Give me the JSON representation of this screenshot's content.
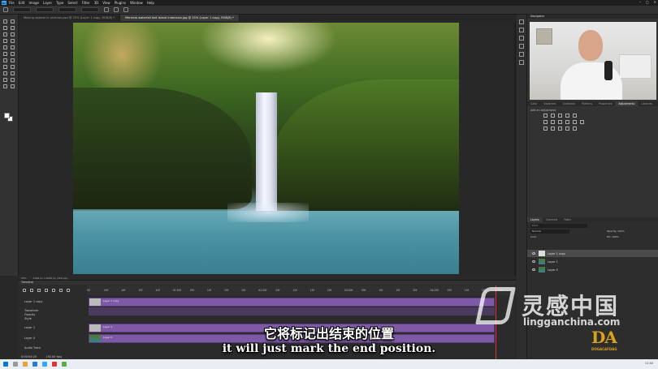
{
  "menubar": {
    "items": [
      "File",
      "Edit",
      "Image",
      "Layer",
      "Type",
      "Select",
      "Filter",
      "3D",
      "View",
      "Plugins",
      "Window",
      "Help"
    ]
  },
  "tabs": [
    {
      "label": "Moving objects in pictures.psd @ 25% (Layer 1 copy, RGB/8) *",
      "active": false
    },
    {
      "label": "Menesia waterfall bali island indonesia.jpg @ 25% (Layer 1 copy, RGB/8) *",
      "active": true
    }
  ],
  "status": {
    "zoom": "25%",
    "doc_info": "4000 px x 4000 px (300 ppi)"
  },
  "timeline": {
    "title": "Timeline",
    "ruler_ticks": [
      "00",
      "05f",
      "10f",
      "15f",
      "20f",
      "01:00f",
      "05f",
      "10f",
      "15f",
      "20f",
      "02:00f",
      "05f",
      "10f",
      "15f",
      "20f",
      "03:00f",
      "05f",
      "10f",
      "15f",
      "20f",
      "04:00f",
      "05f",
      "10f",
      "15f",
      "20f"
    ],
    "tracks": [
      {
        "label": "Layer 1 copy",
        "clip": "Layer 1 copy"
      },
      {
        "label": "Transform",
        "clip": ""
      },
      {
        "label": "Opacity",
        "clip": ""
      },
      {
        "label": "Style",
        "clip": ""
      },
      {
        "label": "Layer 1",
        "clip": "Layer 1"
      },
      {
        "label": "Layer 0",
        "clip": "Layer 0"
      },
      {
        "label": "Audio Track",
        "clip": ""
      }
    ],
    "timecode": "0:00:04:20",
    "fps": "(30.00 fps)"
  },
  "right": {
    "navigator_title": "Navigator",
    "panel_tabs": [
      "Color",
      "Swatches",
      "Gradients",
      "Patterns",
      "Properties",
      "Adjustments",
      "Libraries"
    ],
    "active_tab": "Adjustments",
    "adj_title": "Add an adjustment",
    "layers_tabs": [
      "Layers",
      "Channels",
      "Paths"
    ],
    "kind": "Kind",
    "mode": "Normal",
    "opacity": "Opacity: 100%",
    "lock": "Lock:",
    "fill": "Fill: 100%",
    "layers": [
      {
        "name": "Layer 1 copy",
        "selected": true
      },
      {
        "name": "Layer 1",
        "selected": false
      },
      {
        "name": "Layer 0",
        "selected": false
      }
    ]
  },
  "subtitle": {
    "zh": "它将标记出结束的位置",
    "en": "it will just mark the end position."
  },
  "watermark": {
    "cn": "灵感中国",
    "url": "lingganchina.com",
    "da": "DA",
    "da_small": "DOGACAFDAG"
  },
  "taskbar": {
    "clock": "11:40"
  },
  "colors": {
    "clip_purple": "#7e5aa6",
    "accent_blue": "#31a8ff",
    "da_gold": "#d9a21b"
  }
}
